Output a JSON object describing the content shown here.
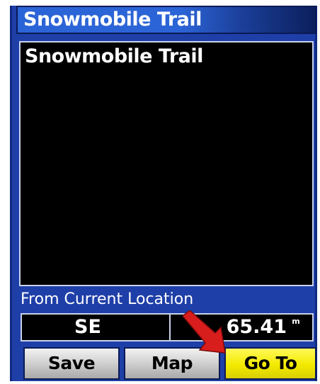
{
  "title_bar": {
    "title": "Snowmobile Trail"
  },
  "main": {
    "name": "Snowmobile Trail"
  },
  "location": {
    "label": "From Current Location",
    "direction": "SE",
    "distance": "65.41",
    "unit": "m"
  },
  "buttons": {
    "save": "Save",
    "map": "Map",
    "goto": "Go To"
  },
  "colors": {
    "background": "#1f3fa8",
    "title_bar": "#2b64d6",
    "highlight_button": "#f3ea00",
    "pointer_arrow": "#d81d1d"
  },
  "icons": {
    "pointer": "red-arrow-icon"
  }
}
